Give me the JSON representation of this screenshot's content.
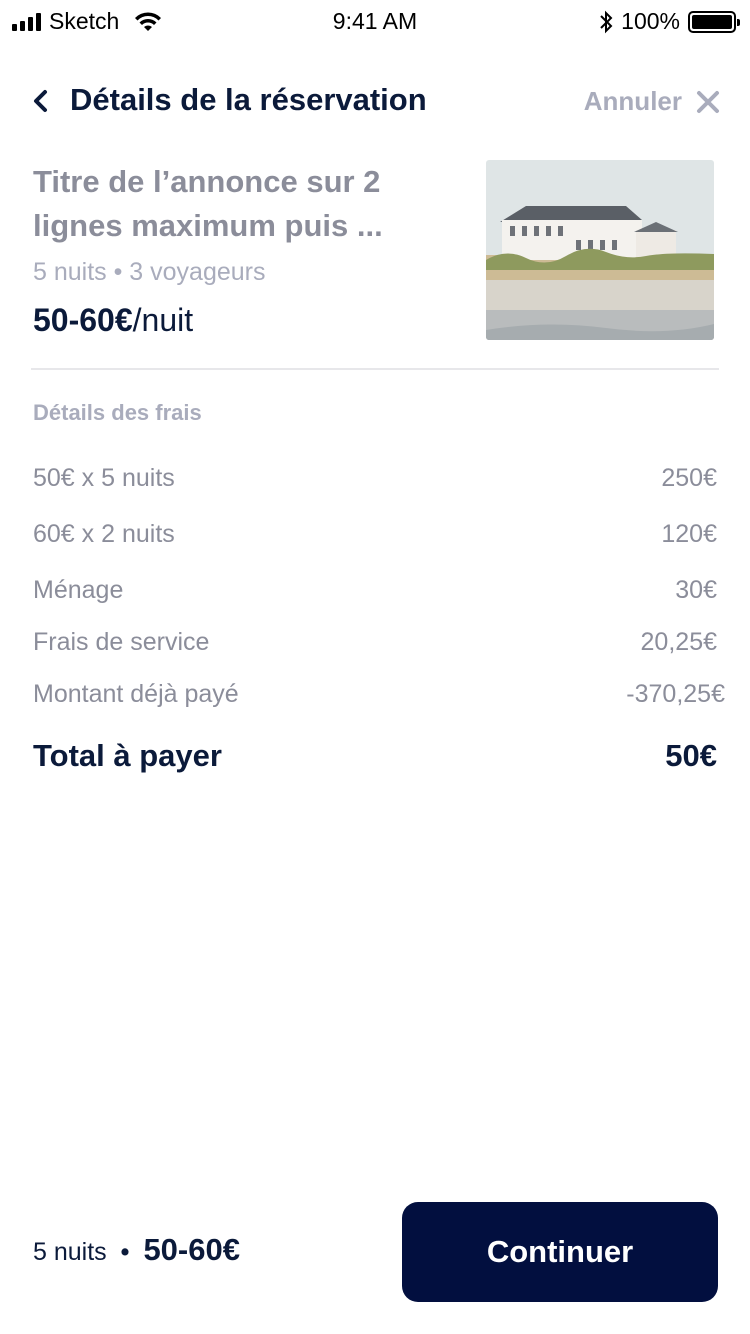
{
  "status_bar": {
    "carrier": "Sketch",
    "time": "9:41 AM",
    "battery": "100%",
    "battery_level": 1.0
  },
  "header": {
    "title": "Détails de la réservation",
    "cancel_label": "Annuler",
    "back_icon": "chevron-left-icon",
    "close_icon": "close-icon"
  },
  "listing": {
    "title": "Titre de l’annonce sur 2 lignes maximum puis ...",
    "meta": "5 nuits • 3 voyageurs",
    "price_bold": "50-60€",
    "price_unit": "/nuit"
  },
  "fees": {
    "heading": "Détails des frais",
    "rows": [
      {
        "label": "50€ x 5 nuits",
        "amount": "250€"
      },
      {
        "label": "60€ x 2 nuits",
        "amount": "120€"
      },
      {
        "label": "Ménage",
        "amount": "30€"
      },
      {
        "label": "Frais de service",
        "amount": "20,25€"
      },
      {
        "label": "Montant déjà payé",
        "amount": "-370,25€"
      }
    ],
    "total_label": "Total à payer",
    "total_amount": "50€"
  },
  "bottom_bar": {
    "nights": "5 nuits",
    "separator": "•",
    "price": "50-60€",
    "continue_label": "Continuer"
  },
  "colors": {
    "primary": "#020f3f",
    "text_dark": "#0b1a3a",
    "text_muted": "#8b8d9a",
    "text_light": "#a9acbc"
  }
}
